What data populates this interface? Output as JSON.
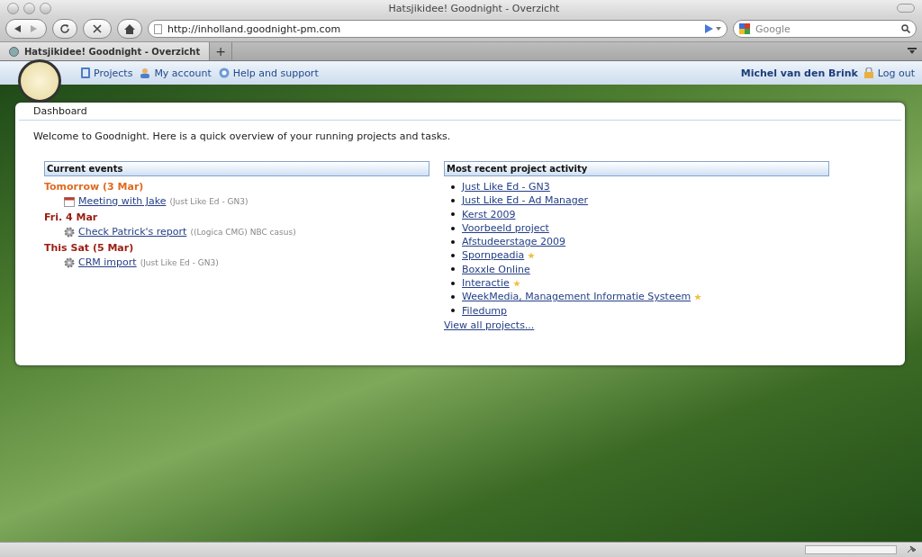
{
  "window": {
    "title": "Hatsjikidee! Goodnight - Overzicht"
  },
  "toolbar": {
    "url": "http://inholland.goodnight-pm.com",
    "search": {
      "placeholder": "Google"
    }
  },
  "tabs": [
    {
      "label": "Hatsjikidee! Goodnight - Overzicht",
      "selected": true
    },
    {
      "label": "+",
      "selected": false
    }
  ],
  "site_nav": {
    "links": [
      "Projects",
      "My account",
      "Help and support"
    ],
    "user": "Michel van den Brink",
    "logout": "Log out"
  },
  "dashboard": {
    "title": "Dashboard",
    "intro": "Welcome to Goodnight. Here is a quick overview of your running projects and tasks.",
    "events": {
      "heading": "Current events",
      "days": [
        {
          "label": "Tomorrow (3 Mar)",
          "color": "#e06a20",
          "items": [
            {
              "kind": "meeting",
              "title": "Meeting with Jake",
              "project": "(Just Like Ed - GN3)"
            }
          ]
        },
        {
          "label": "Fri. 4 Mar",
          "color": "#9a1c10",
          "items": [
            {
              "kind": "task",
              "title": "Check Patrick's report",
              "project": "((Logica CMG) NBC casus)"
            }
          ]
        },
        {
          "label": "This Sat (5 Mar)",
          "color": "#9a1c10",
          "items": [
            {
              "kind": "task",
              "title": "CRM import",
              "project": "(Just Like Ed - GN3)"
            }
          ]
        }
      ]
    },
    "activity": {
      "heading": "Most recent project activity",
      "projects": [
        {
          "name": "Just Like Ed - GN3",
          "starred": false
        },
        {
          "name": "Just Like Ed - Ad Manager",
          "starred": false
        },
        {
          "name": "Kerst 2009",
          "starred": false
        },
        {
          "name": "Voorbeeld project",
          "starred": false
        },
        {
          "name": "Afstudeerstage 2009",
          "starred": false
        },
        {
          "name": "Spornpeadia",
          "starred": true
        },
        {
          "name": "Boxxle Online",
          "starred": false
        },
        {
          "name": "Interactie",
          "starred": true
        },
        {
          "name": "WeekMedia, Management Informatie Systeem",
          "starred": true
        },
        {
          "name": "Filedump",
          "starred": false
        }
      ],
      "view_all": "View all projects..."
    }
  }
}
